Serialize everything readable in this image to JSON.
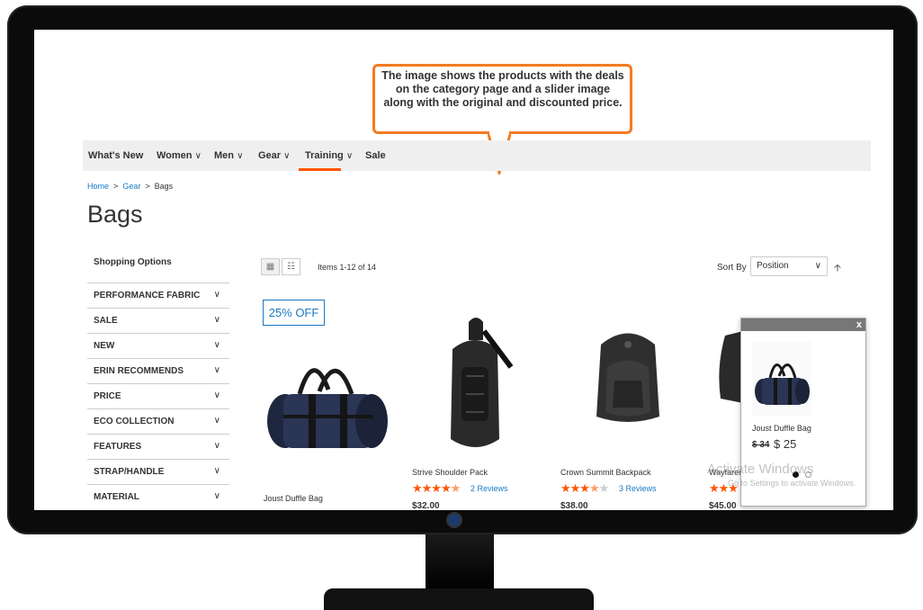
{
  "callout": {
    "text": "The image shows the products with the deals on the category page and a slider image along with the original and discounted price."
  },
  "nav": {
    "items": [
      {
        "label": "What's New",
        "chevron": ""
      },
      {
        "label": "Women",
        "chevron": "∨"
      },
      {
        "label": "Men",
        "chevron": "∨"
      },
      {
        "label": "Gear",
        "chevron": "∨"
      },
      {
        "label": "Training",
        "chevron": "∨"
      },
      {
        "label": "Sale",
        "chevron": ""
      }
    ],
    "active": "Gear",
    "accent": "#ff5501"
  },
  "breadcrumb": {
    "home": "Home",
    "sep": ">",
    "gear": "Gear",
    "current": "Bags"
  },
  "page_title": "Bags",
  "sidebar": {
    "title": "Shopping Options",
    "filters": [
      "PERFORMANCE FABRIC",
      "SALE",
      "NEW",
      "ERIN RECOMMENDS",
      "PRICE",
      "ECO COLLECTION",
      "FEATURES",
      "STRAP/HANDLE",
      "MATERIAL"
    ]
  },
  "toolbar": {
    "items_count": "Items 1-12 of 14",
    "sort_by_label": "Sort By",
    "sort_value": "Position"
  },
  "badge": "25% OFF",
  "products": [
    {
      "name": "Joust Duffle Bag",
      "price": "",
      "reviews": "",
      "rating": 0
    },
    {
      "name": "Strive Shoulder Pack",
      "price": "$32.00",
      "reviews": "2 Reviews",
      "rating": 4.5
    },
    {
      "name": "Crown Summit Backpack",
      "price": "$38.00",
      "reviews": "3 Reviews",
      "rating": 3.5
    },
    {
      "name": "Wayfarer",
      "price": "$45.00",
      "reviews": "",
      "rating": 3
    }
  ],
  "popup": {
    "close": "x",
    "product_name": "Joust Duffle Bag",
    "old_price": "$ 34",
    "new_price": "$ 25"
  },
  "watermark": {
    "line1": "Activate Windows",
    "line2": "Go to Settings to activate Windows."
  },
  "colors": {
    "link": "#1979c3",
    "star": "#ff5501",
    "callout_border": "#f47b20"
  }
}
